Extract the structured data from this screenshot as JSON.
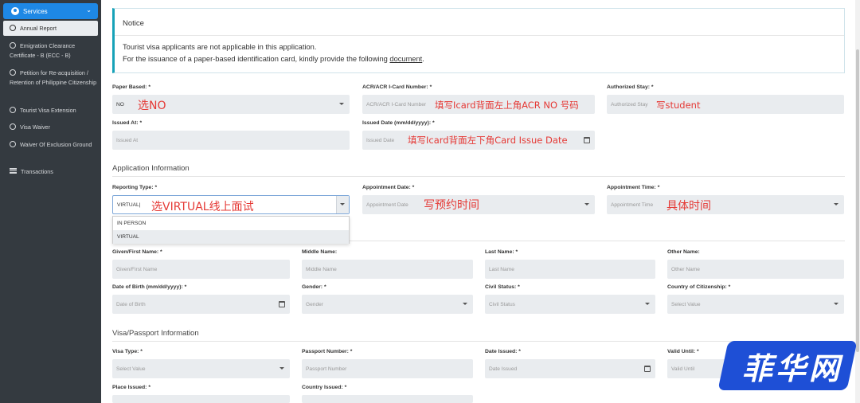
{
  "sidebar": {
    "services_label": "Services",
    "items": [
      {
        "label": "Annual Report"
      },
      {
        "label": "Emigration Clearance Certificate - B (ECC - B)"
      },
      {
        "label": "Petition for Re-acquisition / Retention of Philippine Citizenship"
      },
      {
        "label": "Tourist Visa Extension"
      },
      {
        "label": "Visa Waiver"
      },
      {
        "label": "Waiver Of Exclusion Ground"
      },
      {
        "label": "Transactions"
      }
    ]
  },
  "notice": {
    "title": "Notice",
    "line1": "Tourist visa applicants are not applicable in this application.",
    "line2_pre": "For the issuance of a paper-based identification card, kindly provide the following ",
    "line2_link": "document",
    "line2_post": "."
  },
  "fields": {
    "paper_based": {
      "label": "Paper Based: *",
      "value": "NO"
    },
    "acr_number": {
      "label": "ACR/ACR I-Card Number: *",
      "placeholder": "ACR/ACR I-Card Number"
    },
    "authorized_stay": {
      "label": "Authorized Stay: *",
      "placeholder": "Authorized Stay"
    },
    "issued_at": {
      "label": "Issued At: *",
      "placeholder": "Issued At"
    },
    "issued_date": {
      "label": "Issued Date (mm/dd/yyyy): *",
      "placeholder": "Issued Date"
    },
    "reporting_type": {
      "label": "Reporting Type: *",
      "value": "VIRTUAL|"
    },
    "appointment_date": {
      "label": "Appointment Date: *",
      "placeholder": "Appointment Date"
    },
    "appointment_time": {
      "label": "Appointment Time: *",
      "placeholder": "Appointment Time"
    },
    "given_name": {
      "label": "Given/First Name: *",
      "placeholder": "Given/First Name"
    },
    "middle_name": {
      "label": "Middle Name:",
      "placeholder": "Middle Name"
    },
    "last_name": {
      "label": "Last Name: *",
      "placeholder": "Last Name"
    },
    "other_name": {
      "label": "Other Name:",
      "placeholder": "Other Name"
    },
    "dob": {
      "label": "Date of Birth (mm/dd/yyyy): *",
      "placeholder": "Date of Birth"
    },
    "gender": {
      "label": "Gender: *",
      "placeholder": "Gender"
    },
    "civil_status": {
      "label": "Civil Status: *",
      "placeholder": "Civil Status"
    },
    "citizenship": {
      "label": "Country of Citizenship: *",
      "placeholder": "Select Value"
    },
    "visa_type": {
      "label": "Visa Type: *",
      "placeholder": "Select Value"
    },
    "passport_number": {
      "label": "Passport Number: *",
      "placeholder": "Passport Number"
    },
    "date_issued": {
      "label": "Date Issued: *",
      "placeholder": "Date Issued"
    },
    "valid_until": {
      "label": "Valid Until: *",
      "placeholder": "Valid Until"
    },
    "place_issued": {
      "label": "Place Issued: *"
    },
    "country_issued": {
      "label": "Country Issued: *"
    }
  },
  "sections": {
    "application_info": "Application Information",
    "visa_passport_info": "Visa/Passport Information"
  },
  "dropdown": {
    "options": [
      "IN PERSON",
      "VIRTUAL"
    ]
  },
  "annotations": {
    "paper_based": "选NO",
    "acr": "填写Icard背面左上角ACR NO 号码",
    "stay": "写student",
    "issue_date": "填写Icard背面左下角Card Issue Date",
    "reporting": "选VIRTUAL线上面试",
    "appt_date": "写预约时间",
    "appt_time": "具体时间"
  },
  "watermark": "菲华网"
}
